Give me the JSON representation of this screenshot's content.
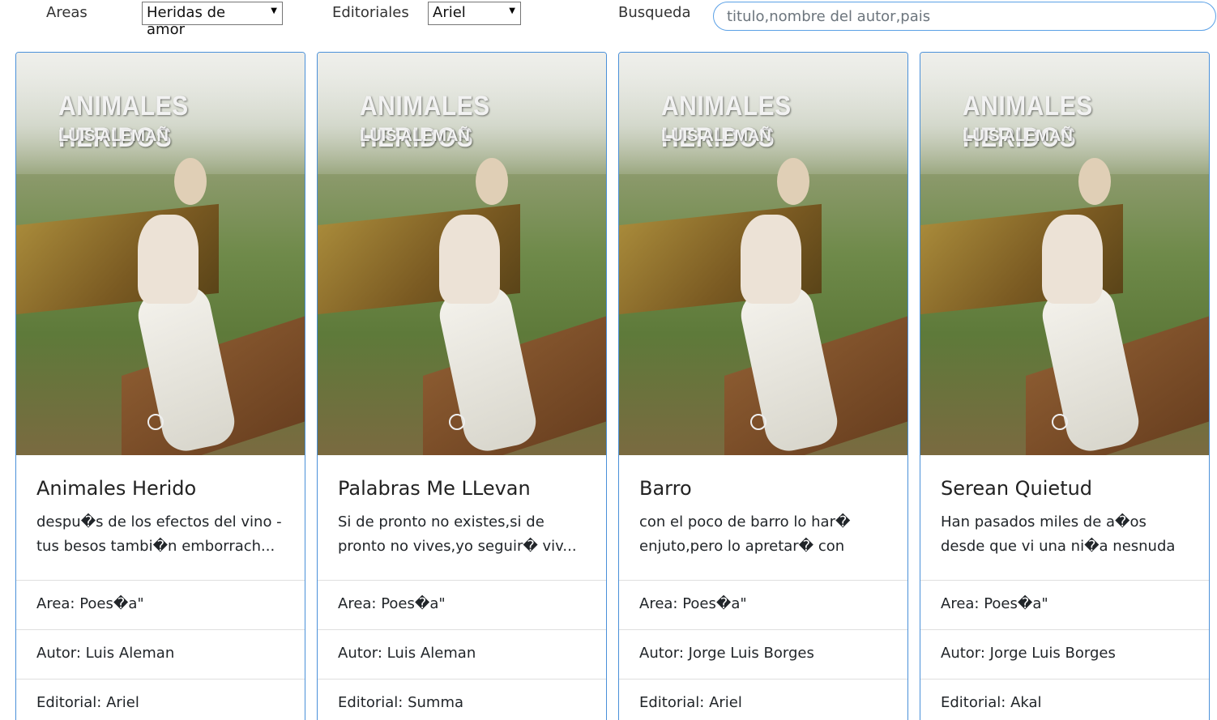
{
  "filters": {
    "areas_label": "Areas",
    "areas_value": "Heridas de amor",
    "editoriales_label": "Editoriales",
    "editoriales_value": "Ariel",
    "busqueda_label": "Busqueda",
    "search_placeholder": "titulo,nombre del autor,pais"
  },
  "cover": {
    "title": "ANIMALES HERIDOS",
    "author": "LUIS ALEMAÑ"
  },
  "cards": [
    {
      "title": "Animales Herido",
      "description": "despu�s de los efectos del vino - tus besos tambi�n emborrach...",
      "area": "Area: Poes�a\"",
      "autor": "Autor: Luis Aleman",
      "editorial": "Editorial: Ariel"
    },
    {
      "title": "Palabras Me LLevan",
      "description": "Si de pronto no existes,si de pronto no vives,yo seguir� viv...",
      "area": "Area: Poes�a\"",
      "autor": "Autor: Luis Aleman",
      "editorial": "Editorial: Summa"
    },
    {
      "title": "Barro",
      "description": "con el poco de barro lo har� enjuto,pero lo apretar� con ene...",
      "area": "Area: Poes�a\"",
      "autor": "Autor: Jorge Luis Borges",
      "editorial": "Editorial: Ariel"
    },
    {
      "title": "Serean Quietud",
      "description": "Han pasados miles de a�os desde que vi una ni�a nesnuda vail...",
      "area": "Area: Poes�a\"",
      "autor": "Autor: Jorge Luis Borges",
      "editorial": "Editorial: Akal"
    }
  ]
}
